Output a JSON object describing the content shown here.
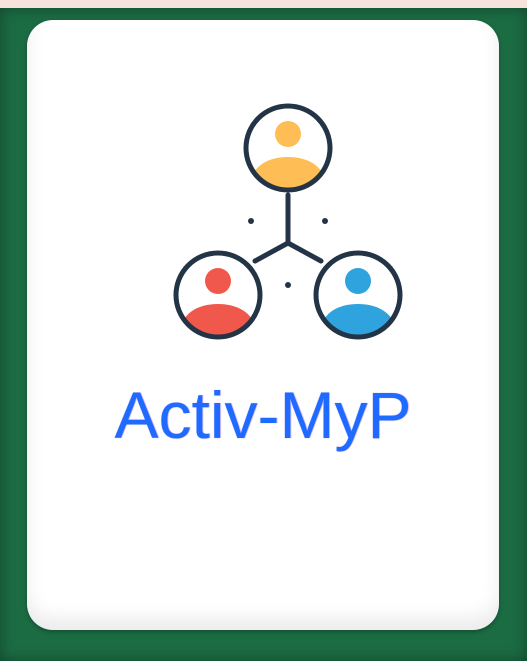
{
  "app": {
    "tile_label": "Activ-MyP",
    "icon": "people-network-icon",
    "colors": {
      "page_background": "#f6e3dc",
      "frame": "#1b6b43",
      "card": "#ffffff",
      "label": "#1f6bff",
      "person_top": "#ffbe55",
      "person_left": "#f0584c",
      "person_right": "#2ea3de",
      "outline": "#243447"
    }
  }
}
